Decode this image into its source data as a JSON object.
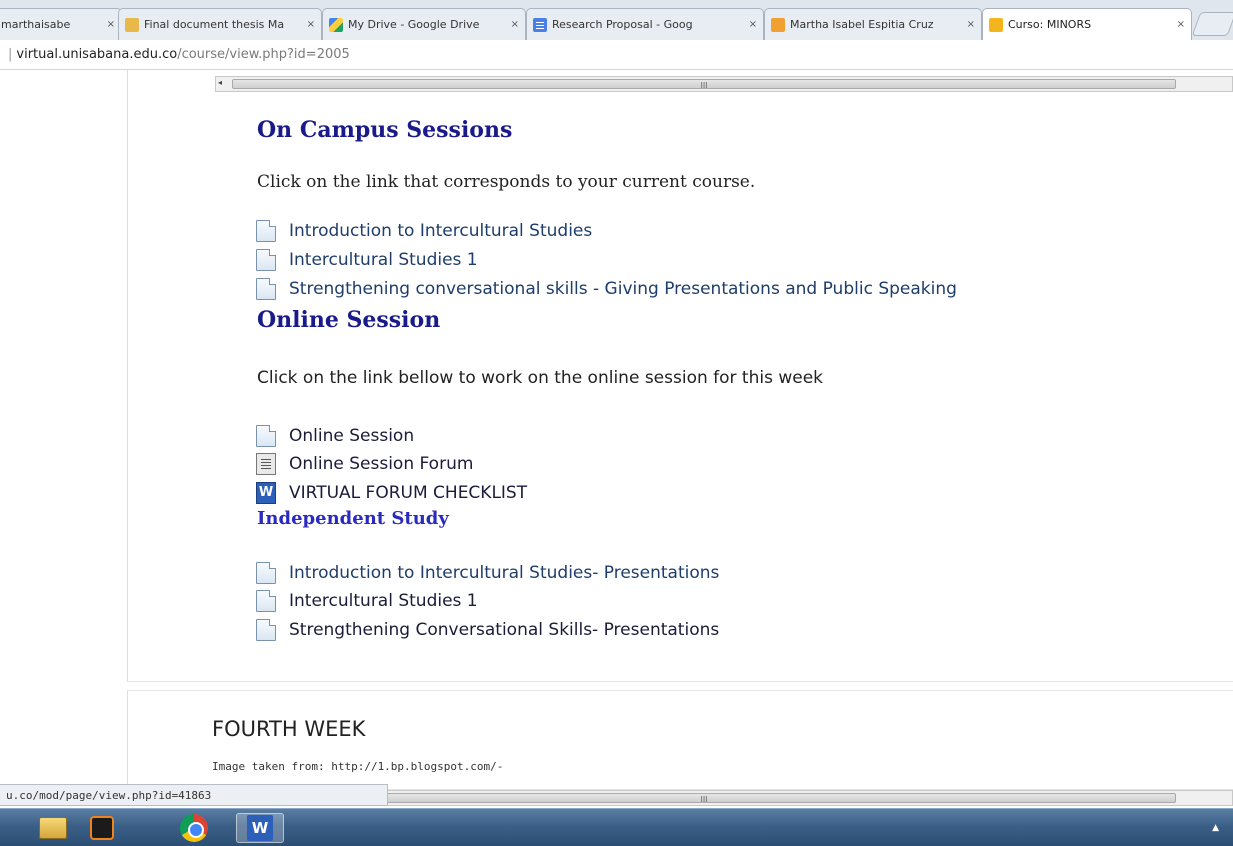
{
  "browser": {
    "tabs": [
      {
        "title": "marthaisabe",
        "icon": "mail-icon"
      },
      {
        "title": "Final document thesis Ma",
        "icon": "folder-icon"
      },
      {
        "title": "My Drive - Google Drive",
        "icon": "drive-icon"
      },
      {
        "title": "Research Proposal - Goog",
        "icon": "docs-icon"
      },
      {
        "title": "Martha Isabel Espitia Cruz",
        "icon": "mail-icon"
      },
      {
        "title": "Curso: MINORS",
        "icon": "moodle-icon",
        "active": true
      }
    ],
    "close_glyph": "×",
    "address": {
      "separator": "|",
      "host": "virtual.unisabana.edu.co",
      "path": "/course/view.php?id=2005"
    },
    "scroll_grip": "III",
    "scroll_arrow": "◂",
    "status_url": "u.co/mod/page/view.php?id=41863"
  },
  "main": {
    "on_campus": {
      "heading": "On Campus Sessions",
      "intro": "Click on the link that corresponds to your current course.",
      "items": [
        {
          "label": "Introduction to Intercultural Studies",
          "icon": "page-icon"
        },
        {
          "label": "Intercultural Studies 1",
          "icon": "page-icon"
        },
        {
          "label": "Strengthening conversational skills - Giving Presentations and Public Speaking",
          "icon": "page-icon"
        }
      ]
    },
    "online": {
      "heading": "Online Session",
      "intro": "Click on the link bellow to work on the online session for this week",
      "items": [
        {
          "label": "Online Session",
          "icon": "page-icon"
        },
        {
          "label": "Online Session Forum",
          "icon": "forum-icon"
        },
        {
          "label": "VIRTUAL FORUM CHECKLIST",
          "icon": "word-icon"
        }
      ]
    },
    "independent": {
      "heading": "Independent Study",
      "items": [
        {
          "label": "Introduction to Intercultural Studies- Presentations",
          "icon": "page-icon"
        },
        {
          "label": "Intercultural Studies 1",
          "icon": "page-icon"
        },
        {
          "label": "Strengthening Conversational Skills- Presentations",
          "icon": "page-icon"
        }
      ]
    },
    "fourth_week": {
      "title": "FOURTH WEEK",
      "caption": "Image taken from: http://1.bp.blogspot.com/-"
    }
  },
  "taskbar": {
    "word_glyph": "W",
    "tray_arrow": "▲",
    "items": [
      "explorer-icon",
      "media-player-icon",
      "chrome-icon",
      "word-icon"
    ]
  },
  "colors": {
    "heading": "#1a1a8a",
    "heading_small": "#2a2ac0",
    "link": "#1e3d6b",
    "taskbar": "#3b5f86"
  }
}
